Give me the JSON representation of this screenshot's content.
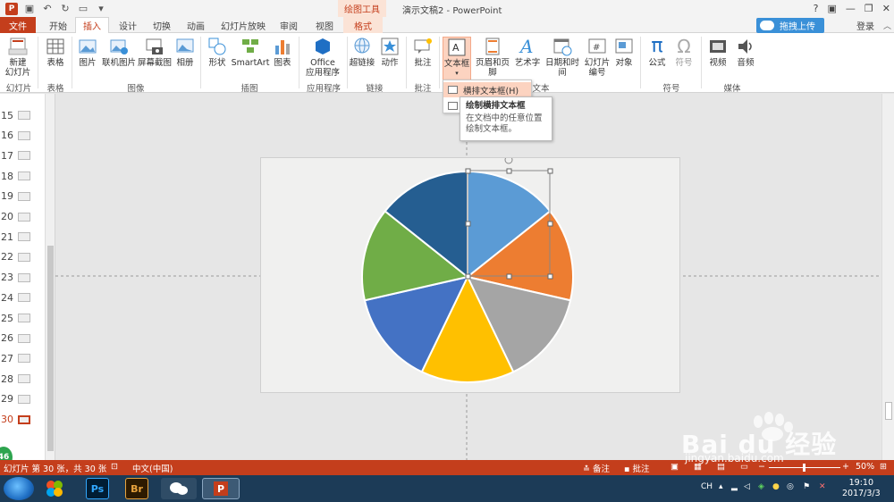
{
  "window": {
    "title": "演示文稿2 - PowerPoint",
    "context_tab_group": "绘图工具",
    "login": "登录",
    "upload_button": "拖拽上传",
    "help": "?"
  },
  "tabs": [
    {
      "label": "文件"
    },
    {
      "label": "开始"
    },
    {
      "label": "插入"
    },
    {
      "label": "设计"
    },
    {
      "label": "切换"
    },
    {
      "label": "动画"
    },
    {
      "label": "幻灯片放映"
    },
    {
      "label": "审阅"
    },
    {
      "label": "视图"
    },
    {
      "label": "格式"
    }
  ],
  "ribbon": {
    "new_slide": "新建\n幻灯片",
    "table": "表格",
    "picture": "图片",
    "online_picture": "联机图片",
    "screenshot": "屏幕截图",
    "album": "相册",
    "shapes": "形状",
    "smartart": "SmartArt",
    "chart": "图表",
    "office_apps": "Office\n应用程序",
    "hyperlink": "超链接",
    "action": "动作",
    "comment": "批注",
    "textbox": "文本框",
    "header_footer": "页眉和页脚",
    "wordart": "艺术字",
    "datetime": "日期和时间",
    "slide_number": "幻灯片\n编号",
    "object": "对象",
    "equation": "公式",
    "symbol": "符号",
    "video": "视频",
    "audio": "音频",
    "groups": {
      "slides": "幻灯片",
      "tables": "表格",
      "images": "图像",
      "illustrations": "插图",
      "apps": "应用程序",
      "links": "链接",
      "comments": "批注",
      "text": "文本",
      "symbols": "符号",
      "media": "媒体"
    }
  },
  "dropdown": {
    "items": [
      {
        "label": "横排文本框(H)"
      }
    ]
  },
  "tooltip": {
    "title": "绘制横排文本框",
    "desc": "在文档中的任意位置绘制文本框。"
  },
  "slides_panel": {
    "numbers": [
      "15",
      "16",
      "17",
      "18",
      "19",
      "20",
      "21",
      "22",
      "23",
      "24",
      "25",
      "26",
      "27",
      "28",
      "29",
      "30"
    ],
    "current": "30",
    "badge": "46"
  },
  "pie": {
    "slice_colors": [
      "#5b9bd5",
      "#ed7d31",
      "#a5a5a5",
      "#ffc000",
      "#4472c4",
      "#70ad47",
      "#255e91"
    ]
  },
  "statusbar": {
    "slide_info": "幻灯片 第 30 张，共 30 张",
    "language": "中文(中国)",
    "notes": "备注",
    "comments": "批注",
    "zoom": "50%"
  },
  "taskbar": {
    "apps": [
      "Ps",
      "Br",
      "微信",
      "PowerPoint"
    ],
    "ime": "CH",
    "time": "19:10",
    "date": "2017/3/3"
  },
  "watermark": {
    "brand": "Bai du 经验",
    "url": "jingyan.baidu.com"
  },
  "colors": {
    "accent": "#c43e1c",
    "accent_light": "#fcd3c0",
    "upload_blue": "#3a90d8",
    "taskbar": "#1c3b57"
  }
}
